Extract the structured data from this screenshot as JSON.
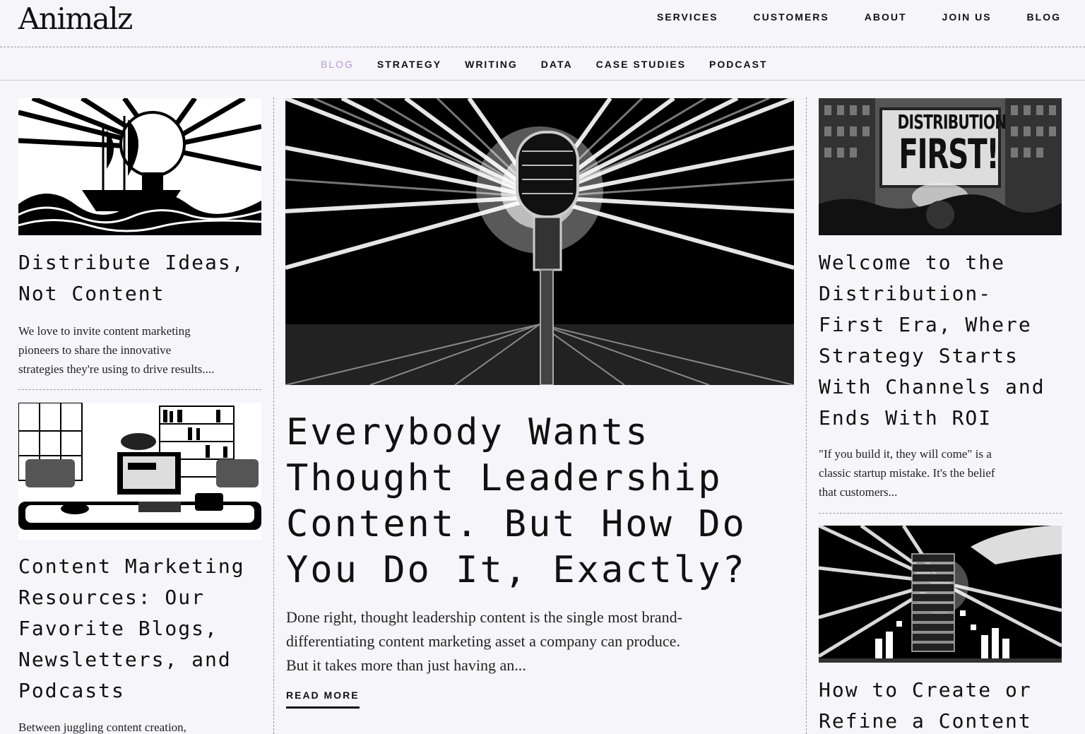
{
  "brand": {
    "logo": "Animalz"
  },
  "main_nav": [
    {
      "label": "SERVICES"
    },
    {
      "label": "CUSTOMERS"
    },
    {
      "label": "ABOUT"
    },
    {
      "label": "JOIN US"
    },
    {
      "label": "BLOG"
    }
  ],
  "sub_nav": [
    {
      "label": "BLOG",
      "active": true
    },
    {
      "label": "STRATEGY"
    },
    {
      "label": "WRITING"
    },
    {
      "label": "DATA"
    },
    {
      "label": "CASE STUDIES"
    },
    {
      "label": "PODCAST"
    }
  ],
  "colors": {
    "background": "#f6f5fa",
    "active_nav": "#b39bd8",
    "text": "#111111"
  },
  "posts": {
    "left_top": {
      "image": "lightbulb-ship-illustration",
      "title_lines": [
        "Distribute Ideas,",
        "Not Content"
      ],
      "excerpt_lines": [
        "We love to invite content marketing",
        "pioneers to share the innovative",
        "strategies they're using to drive results...."
      ]
    },
    "left_bottom": {
      "image": "cafe-laptop-illustration",
      "title_lines": [
        "Content Marketing",
        "Resources: Our",
        "Favorite Blogs,",
        "Newsletters, and",
        "Podcasts"
      ],
      "excerpt_lines": [
        "Between juggling content creation,"
      ]
    },
    "featured": {
      "image": "microphone-spotlight-illustration",
      "title_lines": [
        "Everybody Wants",
        "Thought Leadership",
        "Content. But How Do",
        "You Do It, Exactly?"
      ],
      "excerpt_lines": [
        "Done right, thought leadership content is the single most brand-",
        "differentiating content marketing asset a company can produce.",
        "But it takes more than just having an..."
      ],
      "read_more": "READ MORE"
    },
    "right_top": {
      "image": "distribution-first-protest-illustration",
      "sign_lines": [
        "DISTRIBUTION",
        "FIRST!"
      ],
      "title_lines": [
        "Welcome to the",
        "Distribution-",
        "First Era, Where",
        "Strategy Starts",
        "With Channels and",
        "Ends With ROI"
      ],
      "excerpt_lines": [
        "\"If you build it, they will come\" is a",
        "classic startup mistake. It's the belief",
        "that customers..."
      ]
    },
    "right_bottom": {
      "image": "block-tower-illustration",
      "title_lines": [
        "How to Create or",
        "Refine a Content"
      ]
    }
  }
}
